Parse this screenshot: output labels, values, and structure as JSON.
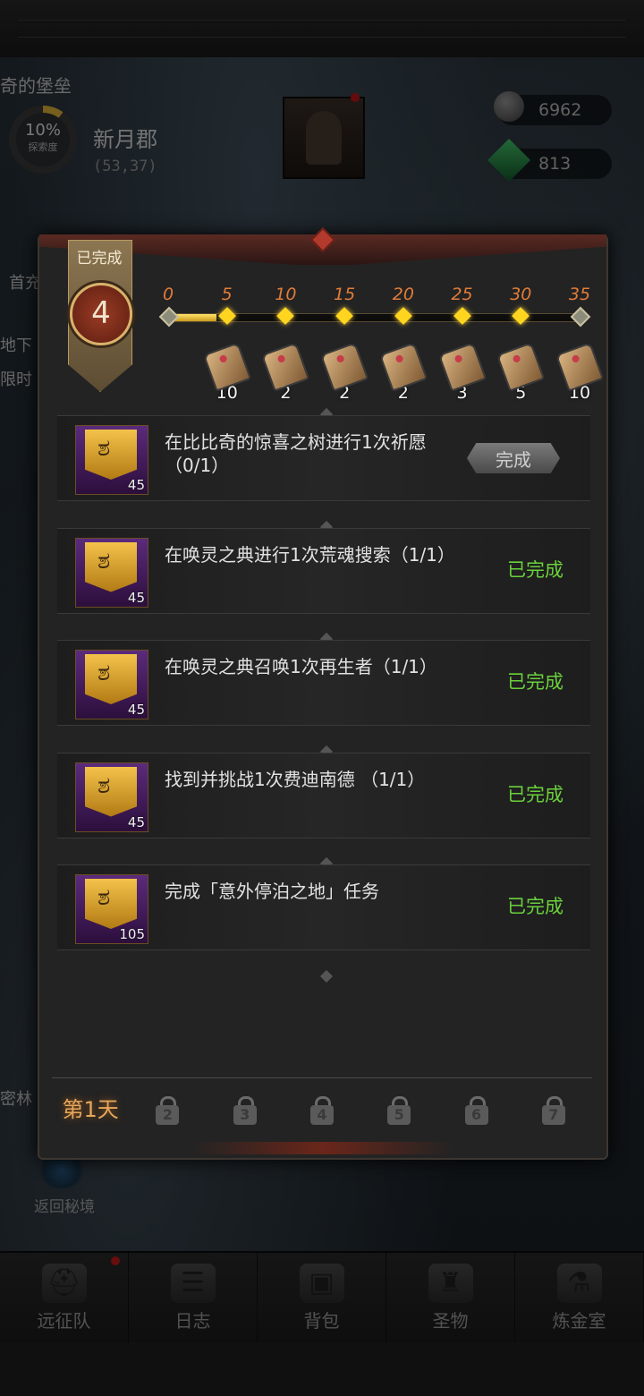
{
  "background": {
    "castle_name": "奇的堡垒",
    "explore_percent": "10%",
    "explore_label": "探索度",
    "region_name": "新月郡",
    "region_coords": "(53,37)",
    "resources": [
      {
        "icon": "stone-icon",
        "value": "6962"
      },
      {
        "icon": "emerald-icon",
        "value": "813"
      }
    ],
    "side_labels": [
      "首充",
      "地下",
      "限时",
      "密林"
    ],
    "back_button": "返回秘境"
  },
  "panel": {
    "completed_label": "已完成",
    "completed_count": "4",
    "progress": {
      "current": 4,
      "max": 35,
      "milestones": [
        {
          "value": "0"
        },
        {
          "value": "5",
          "reward": "10"
        },
        {
          "value": "10",
          "reward": "2"
        },
        {
          "value": "15",
          "reward": "2"
        },
        {
          "value": "20",
          "reward": "2"
        },
        {
          "value": "25",
          "reward": "3"
        },
        {
          "value": "30",
          "reward": "5"
        },
        {
          "value": "35",
          "reward": "10"
        }
      ]
    },
    "tasks": [
      {
        "text": "在比比奇的惊喜之树进行1次祈愿（0/1）",
        "points": "45",
        "status": "完成",
        "button": true
      },
      {
        "text": "在唤灵之典进行1次荒魂搜索（1/1）",
        "points": "45",
        "status": "已完成",
        "button": false
      },
      {
        "text": "在唤灵之典召唤1次再生者（1/1）",
        "points": "45",
        "status": "已完成",
        "button": false
      },
      {
        "text": "找到并挑战1次费迪南德 （1/1）",
        "points": "45",
        "status": "已完成",
        "button": false
      },
      {
        "text": "完成「意外停泊之地」任务",
        "points": "105",
        "status": "已完成",
        "button": false
      }
    ],
    "day_tabs": [
      "第1天",
      "2",
      "3",
      "4",
      "5",
      "6",
      "7"
    ]
  },
  "bottom_nav": [
    {
      "label": "远征队",
      "icon": "viking-helmet-icon"
    },
    {
      "label": "日志",
      "icon": "journal-icon"
    },
    {
      "label": "背包",
      "icon": "backpack-icon"
    },
    {
      "label": "圣物",
      "icon": "chalice-icon"
    },
    {
      "label": "炼金室",
      "icon": "alchemy-icon"
    }
  ],
  "colors": {
    "accent_orange": "#e07c3a",
    "completed_green": "#6ad03c",
    "progress_gold": "#ffd51f"
  }
}
